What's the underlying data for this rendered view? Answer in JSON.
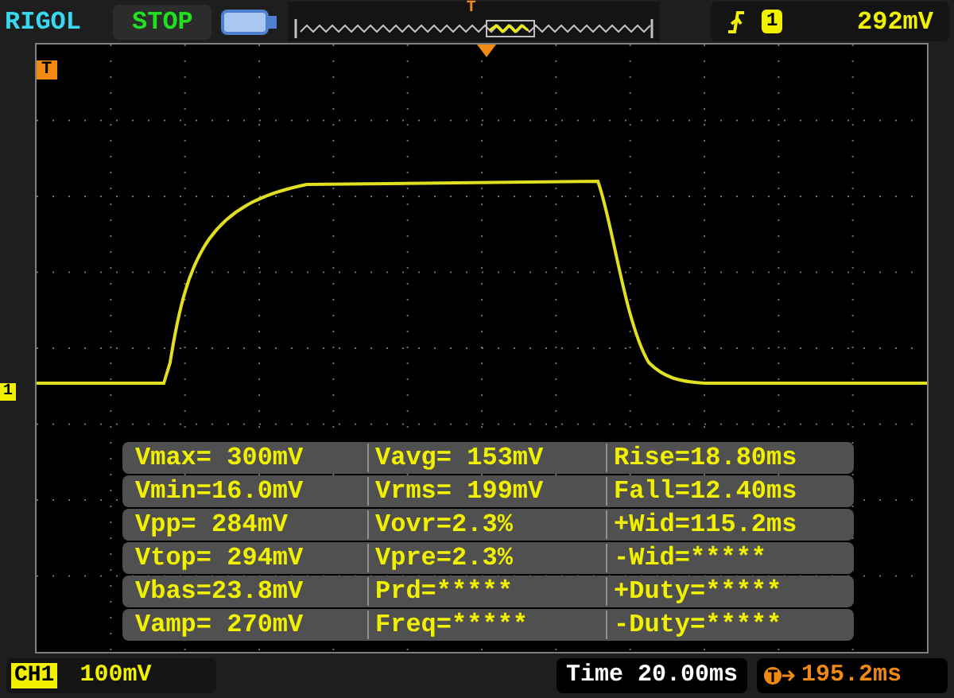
{
  "header": {
    "brand": "RIGOL",
    "run_state": "STOP",
    "trigger_position_label": "T"
  },
  "trigger": {
    "source": "1",
    "threshold": "292mV"
  },
  "markers": {
    "trigger": "T",
    "channel": "1"
  },
  "measurements": [
    {
      "cells": [
        "Vmax= 300mV",
        "Vavg= 153mV",
        "Rise=18.80ms"
      ]
    },
    {
      "cells": [
        "Vmin=16.0mV",
        "Vrms= 199mV",
        "Fall=12.40ms"
      ]
    },
    {
      "cells": [
        "Vpp= 284mV",
        "Vovr=2.3%",
        "+Wid=115.2ms"
      ]
    },
    {
      "cells": [
        "Vtop= 294mV",
        "Vpre=2.3%",
        "-Wid=*****"
      ]
    },
    {
      "cells": [
        "Vbas=23.8mV",
        "Prd=*****",
        "+Duty=*****"
      ]
    },
    {
      "cells": [
        "Vamp= 270mV",
        "Freq=*****",
        "-Duty=*****"
      ]
    }
  ],
  "footer": {
    "channel": "CH1",
    "scale": "100mV",
    "timebase": "Time 20.00ms",
    "offset": "195.2ms"
  }
}
